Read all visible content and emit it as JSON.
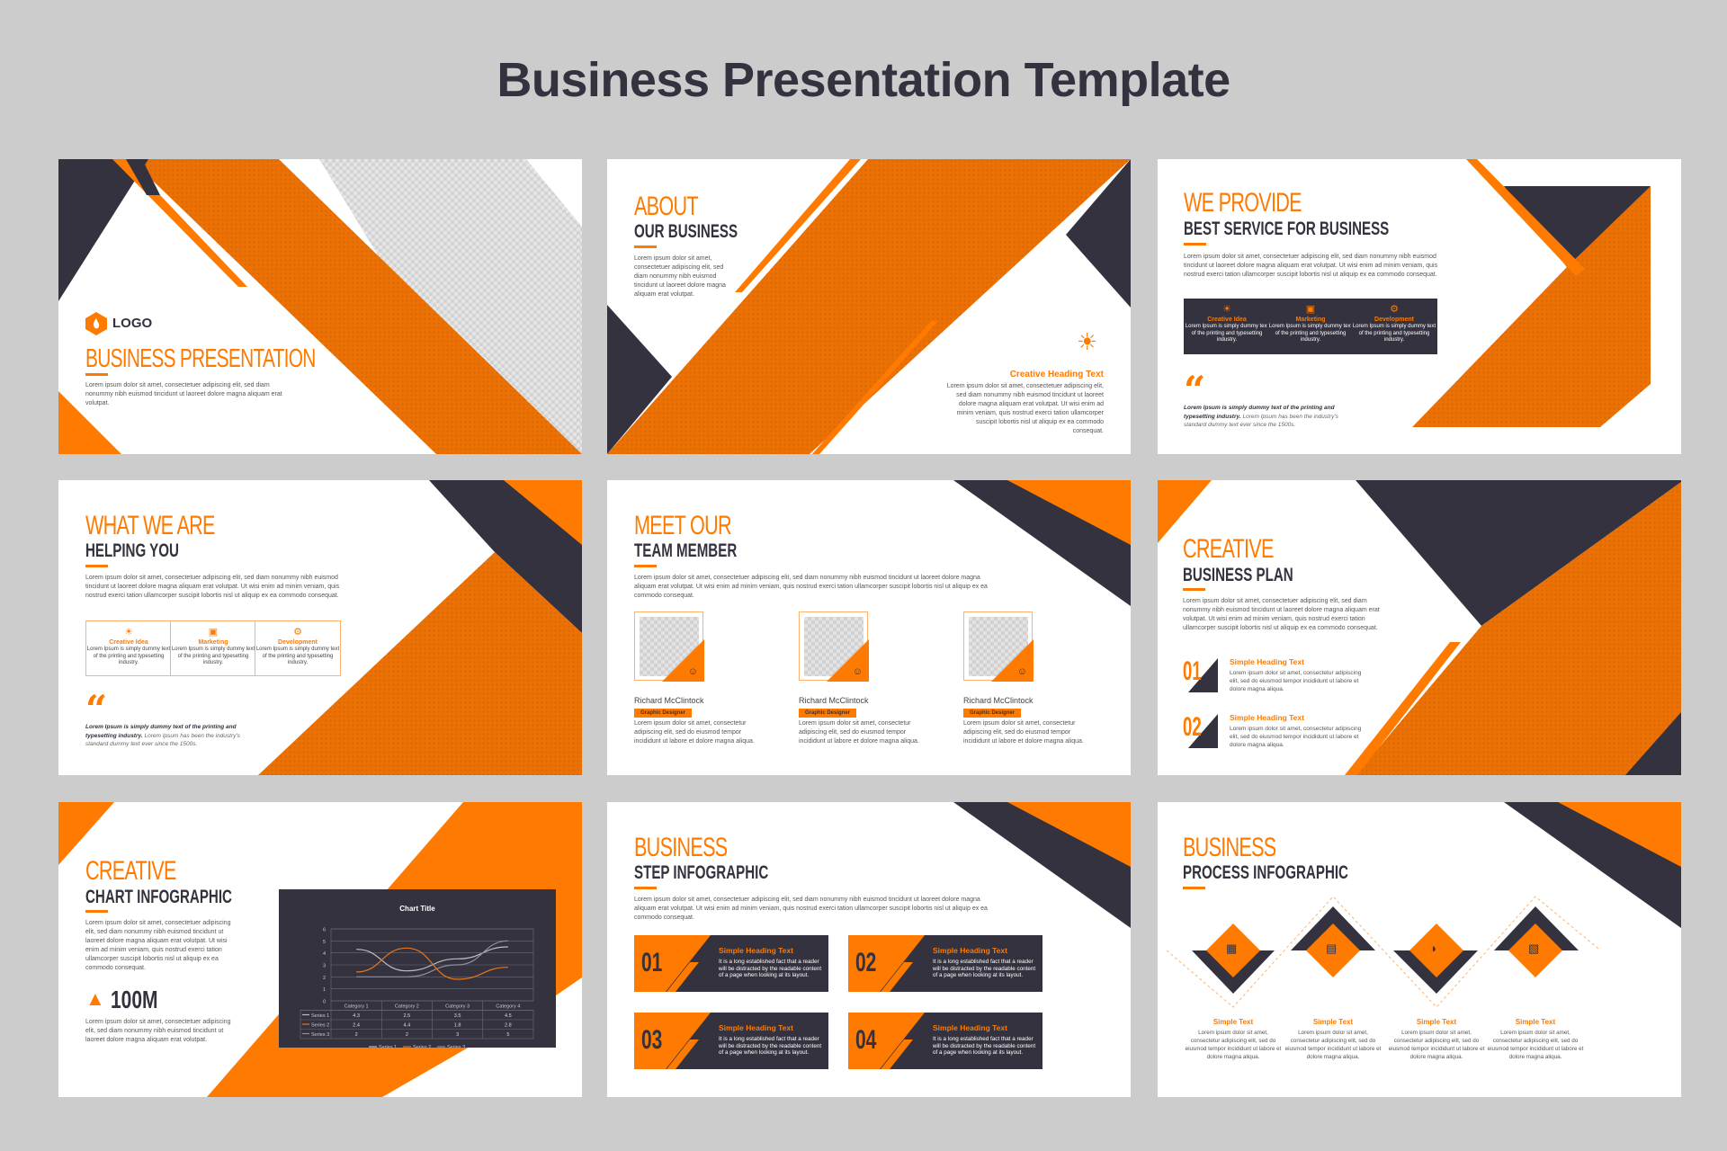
{
  "page": {
    "title": "Business Presentation Template"
  },
  "colors": {
    "accent": "#ff7a00",
    "dark": "#33323e",
    "background": "#cccccc",
    "slide": "#ffffff"
  },
  "lorem": {
    "short": "Lorem ipsum dolor sit amet, consectetuer adipiscing elit, sed diam nonummy nibh euismod tincidunt ut laoreet dolore magna aliquam erat volutpat.",
    "long": "Lorem ipsum dolor sit amet, consectetuer adipiscing elit, sed diam nonummy nibh euismod tincidunt ut laoreet dolore magna aliquam erat volutpat. Ut wisi enim ad minim veniam, quis nostrud exerci tation ullamcorper suscipit lobortis nisl ut aliquip ex ea commodo consequat.",
    "tempor": "Lorem ipsum dolor sit amet, consectetur adipiscing elit, sed do eiusmod tempor incididunt ut labore et dolore magna aliqua."
  },
  "slide1": {
    "logo": "LOGO",
    "logo_icon": "flame-hexagon-icon",
    "title": "BUSINESS PRESENTATION",
    "body": "Lorem ipsum dolor sit amet, consectetuer adipiscing elit, sed diam nonummy nibh euismod tincidunt ut laoreet dolore magna aliquam erat volutpat."
  },
  "slide2": {
    "title_light": "ABOUT",
    "title_bold": "OUR BUSINESS",
    "body": "Lorem ipsum dolor sit amet, consectetuer adipiscing elit, sed diam nonummy nibh euismod tincidunt ut laoreet dolore magna aliquam erat volutpat.",
    "heading": "Creative Heading Text",
    "heading_icon": "lightbulb-icon",
    "heading_body": "Lorem ipsum dolor sit amet, consectetuer adipiscing elit, sed diam nonummy nibh euismod tincidunt ut laoreet dolore magna aliquam erat volutpat. Ut wisi enim ad minim veniam, quis nostrud exerci tation ullamcorper suscipit lobortis nisl ut aliquip ex ea commodo consequat."
  },
  "slide3": {
    "title_light": "WE PROVIDE",
    "title_bold": "BEST SERVICE FOR BUSINESS",
    "body": "Lorem ipsum dolor sit amet, consectetuer adipiscing elit, sed diam nonummy nibh euismod tincidunt ut laoreet dolore magna aliquam erat volutpat. Ut wisi enim ad minim veniam, quis nostrud exerci tation ullamcorper suscipit lobortis nisl ut aliquip ex ea commodo consequat.",
    "cards": [
      {
        "icon": "lightbulb-icon",
        "title": "Creative Idea",
        "text": "Lorem Ipsum is simply dummy text of the printing and typesetting industry."
      },
      {
        "icon": "monitor-chart-icon",
        "title": "Marketing",
        "text": "Lorem Ipsum is simply dummy text of the printing and typesetting industry."
      },
      {
        "icon": "gears-icon",
        "title": "Development",
        "text": "Lorem Ipsum is simply dummy text of the printing and typesetting industry."
      }
    ],
    "quote_bold": "Lorem Ipsum is simply dummy text of the printing and typesetting industry.",
    "quote_rest": " Lorem Ipsum has been the industry's standard dummy text ever since the 1500s."
  },
  "slide4": {
    "title_light": "WHAT WE ARE",
    "title_bold": "HELPING YOU",
    "body": "Lorem ipsum dolor sit amet, consectetuer adipiscing elit, sed diam nonummy nibh euismod tincidunt ut laoreet dolore magna aliquam erat volutpat. Ut wisi enim ad minim veniam, quis nostrud exerci tation ullamcorper suscipit lobortis nisl ut aliquip ex ea commodo consequat.",
    "cards": [
      {
        "icon": "lightbulb-icon",
        "title": "Creative Idea",
        "text": "Lorem Ipsum is simply dummy text of the printing and typesetting industry."
      },
      {
        "icon": "monitor-chart-icon",
        "title": "Marketing",
        "text": "Lorem Ipsum is simply dummy text of the printing and typesetting industry."
      },
      {
        "icon": "gears-icon",
        "title": "Development",
        "text": "Lorem Ipsum is simply dummy text of the printing and typesetting industry."
      }
    ],
    "quote_bold": "Lorem Ipsum is simply dummy text of the printing and typesetting industry.",
    "quote_rest": " Lorem Ipsum has been the industry's standard dummy text ever since the 1500s."
  },
  "slide5": {
    "title_light": "MEET OUR",
    "title_bold": "TEAM MEMBER",
    "body": "Lorem ipsum dolor sit amet, consectetuer adipiscing elit, sed diam nonummy nibh euismod tincidunt ut laoreet dolore magna aliquam erat volutpat. Ut wisi enim ad minim veniam, quis nostrud exerci tation ullamcorper suscipit lobortis nisl ut aliquip ex ea commodo consequat.",
    "members": [
      {
        "name": "Richard McClintock",
        "role": "Graphic Designer",
        "bio": "Lorem ipsum dolor sit amet, consectetur adipiscing elit, sed do eiusmod tempor incididunt ut labore et dolore magna aliqua."
      },
      {
        "name": "Richard McClintock",
        "role": "Graphic Designer",
        "bio": "Lorem ipsum dolor sit amet, consectetur adipiscing elit, sed do eiusmod tempor incididunt ut labore et dolore magna aliqua."
      },
      {
        "name": "Richard McClintock",
        "role": "Graphic Designer",
        "bio": "Lorem ipsum dolor sit amet, consectetur adipiscing elit, sed do eiusmod tempor incididunt ut labore et dolore magna aliqua."
      }
    ]
  },
  "slide6": {
    "title_light": "CREATIVE",
    "title_bold": "BUSINESS PLAN",
    "body": "Lorem ipsum dolor sit amet, consectetuer adipiscing elit, sed diam nonummy nibh euismod tincidunt ut laoreet dolore magna aliquam erat volutpat. Ut wisi enim ad minim veniam, quis nostrud exerci tation ullamcorper suscipit lobortis nisl ut aliquip ex ea commodo consequat.",
    "items": [
      {
        "num": "01",
        "heading": "Simple Heading Text",
        "text": "Lorem ipsum dolor sit amet, consectetur adipiscing elit, sed do eiusmod tempor incididunt ut labore et dolore magna aliqua."
      },
      {
        "num": "02",
        "heading": "Simple Heading Text",
        "text": "Lorem ipsum dolor sit amet, consectetur adipiscing elit, sed do eiusmod tempor incididunt ut labore et dolore magna aliqua."
      }
    ]
  },
  "slide7": {
    "title_light": "CREATIVE",
    "title_bold": "CHART INFOGRAPHIC",
    "body": "Lorem ipsum dolor sit amet, consectetuer adipiscing elit, sed diam nonummy nibh euismod tincidunt ut laoreet dolore magna aliquam erat volutpat. Ut wisi enim ad minim veniam, quis nostrud exerci tation ullamcorper suscipit lobortis nisl ut aliquip ex ea commodo consequat.",
    "stat_icon": "presenter-growth-icon",
    "stat": "100M",
    "stat_body": "Lorem ipsum dolor sit amet, consectetuer adipiscing elit, sed diam nonummy nibh euismod tincidunt ut laoreet dolore magna aliquam erat volutpat."
  },
  "chart_data": {
    "type": "line",
    "title": "Chart Title",
    "categories": [
      "Category 1",
      "Category 2",
      "Category 3",
      "Category 4"
    ],
    "series": [
      {
        "name": "Series 1",
        "values": [
          4.3,
          2.5,
          3.5,
          4.5
        ],
        "color": "#bdbdc4"
      },
      {
        "name": "Series 2",
        "values": [
          2.4,
          4.4,
          1.8,
          2.8
        ],
        "color": "#e8761a"
      },
      {
        "name": "Series 3",
        "values": [
          2,
          2,
          3,
          5
        ],
        "color": "#8f8f99"
      }
    ],
    "ylim": [
      0,
      6
    ],
    "yticks": [
      "0",
      "1",
      "2",
      "3",
      "4",
      "5",
      "6"
    ],
    "xlabel": "",
    "ylabel": "",
    "grid": true,
    "legend": "bottom",
    "data_table": true
  },
  "slide8": {
    "title_light": "BUSINESS",
    "title_bold": "STEP INFOGRAPHIC",
    "body": "Lorem ipsum dolor sit amet, consectetuer adipiscing elit, sed diam nonummy nibh euismod tincidunt ut laoreet dolore magna aliquam erat volutpat. Ut wisi enim ad minim veniam, quis nostrud exerci tation ullamcorper suscipit lobortis nisl ut aliquip ex ea commodo consequat.",
    "steps": [
      {
        "num": "01",
        "heading": "Simple Heading Text",
        "text": "It is a long established fact that a reader will be distracted by the readable content of a page when looking at its layout."
      },
      {
        "num": "02",
        "heading": "Simple Heading Text",
        "text": "It is a long established fact that a reader will be distracted by the readable content of a page when looking at its layout."
      },
      {
        "num": "03",
        "heading": "Simple Heading Text",
        "text": "It is a long established fact that a reader will be distracted by the readable content of a page when looking at its layout."
      },
      {
        "num": "04",
        "heading": "Simple Heading Text",
        "text": "It is a long established fact that a reader will be distracted by the readable content of a page when looking at its layout."
      }
    ]
  },
  "slide9": {
    "title_light": "BUSINESS",
    "title_bold": "PROCESS INFOGRAPHIC",
    "steps": [
      {
        "icon": "hand-bar-chart-icon",
        "title": "Simple Text",
        "text": "Lorem ipsum dolor sit amet, consectetur adipiscing elit, sed do eiusmod tempor incididunt ut labore et dolore magna aliqua."
      },
      {
        "icon": "laptop-growth-icon",
        "title": "Simple Text",
        "text": "Lorem ipsum dolor sit amet, consectetur adipiscing elit, sed do eiusmod tempor incididunt ut labore et dolore magna aliqua."
      },
      {
        "icon": "presenter-dollar-icon",
        "title": "Simple Text",
        "text": "Lorem ipsum dolor sit amet, consectetur adipiscing elit, sed do eiusmod tempor incididunt ut labore et dolore magna aliqua."
      },
      {
        "icon": "office-calculator-icon",
        "title": "Simple Text",
        "text": "Lorem ipsum dolor sit amet, consectetur adipiscing elit, sed do eiusmod tempor incididunt ut labore et dolore magna aliqua."
      }
    ]
  }
}
